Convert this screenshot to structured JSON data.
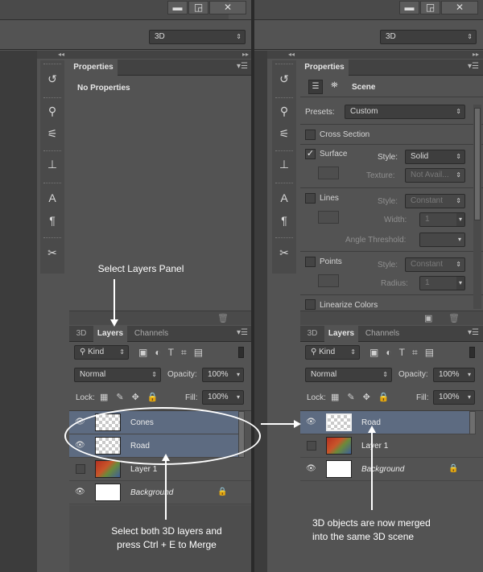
{
  "windowButtons": {
    "minimize": "▬",
    "restore": "◲",
    "close": "✕"
  },
  "workspaceDropdown": {
    "value": "3D"
  },
  "leftPanel": {
    "propertiesTitle": "Properties",
    "noProperties": "No Properties",
    "tabs": [
      "3D",
      "Layers",
      "Channels"
    ],
    "kindLabel": "Kind",
    "blendMode": "Normal",
    "opacityLabel": "Opacity:",
    "opacityValue": "100%",
    "lockLabel": "Lock:",
    "fillLabel": "Fill:",
    "fillValue": "100%",
    "layers": [
      {
        "name": "Cones",
        "selected": true,
        "visible": true
      },
      {
        "name": "Road",
        "selected": true,
        "visible": true
      },
      {
        "name": "Layer 1",
        "selected": false,
        "visible": false
      },
      {
        "name": "Background",
        "selected": false,
        "visible": true
      }
    ]
  },
  "rightPanel": {
    "propertiesTitle": "Properties",
    "sceneLabel": "Scene",
    "presetsLabel": "Presets:",
    "presetsValue": "Custom",
    "crossSection": "Cross Section",
    "surface": "Surface",
    "surfaceStyleLabel": "Style:",
    "surfaceStyleValue": "Solid",
    "textureLabel": "Texture:",
    "textureValue": "Not Avail...",
    "lines": "Lines",
    "linesStyleLabel": "Style:",
    "linesStyleValue": "Constant",
    "widthLabel": "Width:",
    "widthValue": "1",
    "angleThreshold": "Angle Threshold:",
    "points": "Points",
    "pointsStyleLabel": "Style:",
    "pointsStyleValue": "Constant",
    "radiusLabel": "Radius:",
    "radiusValue": "1",
    "linearize": "Linearize Colors",
    "tabs": [
      "3D",
      "Layers",
      "Channels"
    ],
    "kindLabel": "Kind",
    "blendMode": "Normal",
    "opacityLabel": "Opacity:",
    "opacityValue": "100%",
    "lockLabel": "Lock:",
    "fillLabel": "Fill:",
    "fillValue": "100%",
    "layers": [
      {
        "name": "Road",
        "selected": true,
        "visible": true
      },
      {
        "name": "Layer 1",
        "selected": false,
        "visible": false
      },
      {
        "name": "Background",
        "selected": false,
        "visible": true
      }
    ]
  },
  "annotations": {
    "selectLayers": "Select Layers Panel",
    "selectBothLine1": "Select both 3D layers and",
    "selectBothLine2": "press Ctrl + E to Merge",
    "mergedLine1": "3D objects are now merged",
    "mergedLine2": "into the same 3D scene"
  }
}
